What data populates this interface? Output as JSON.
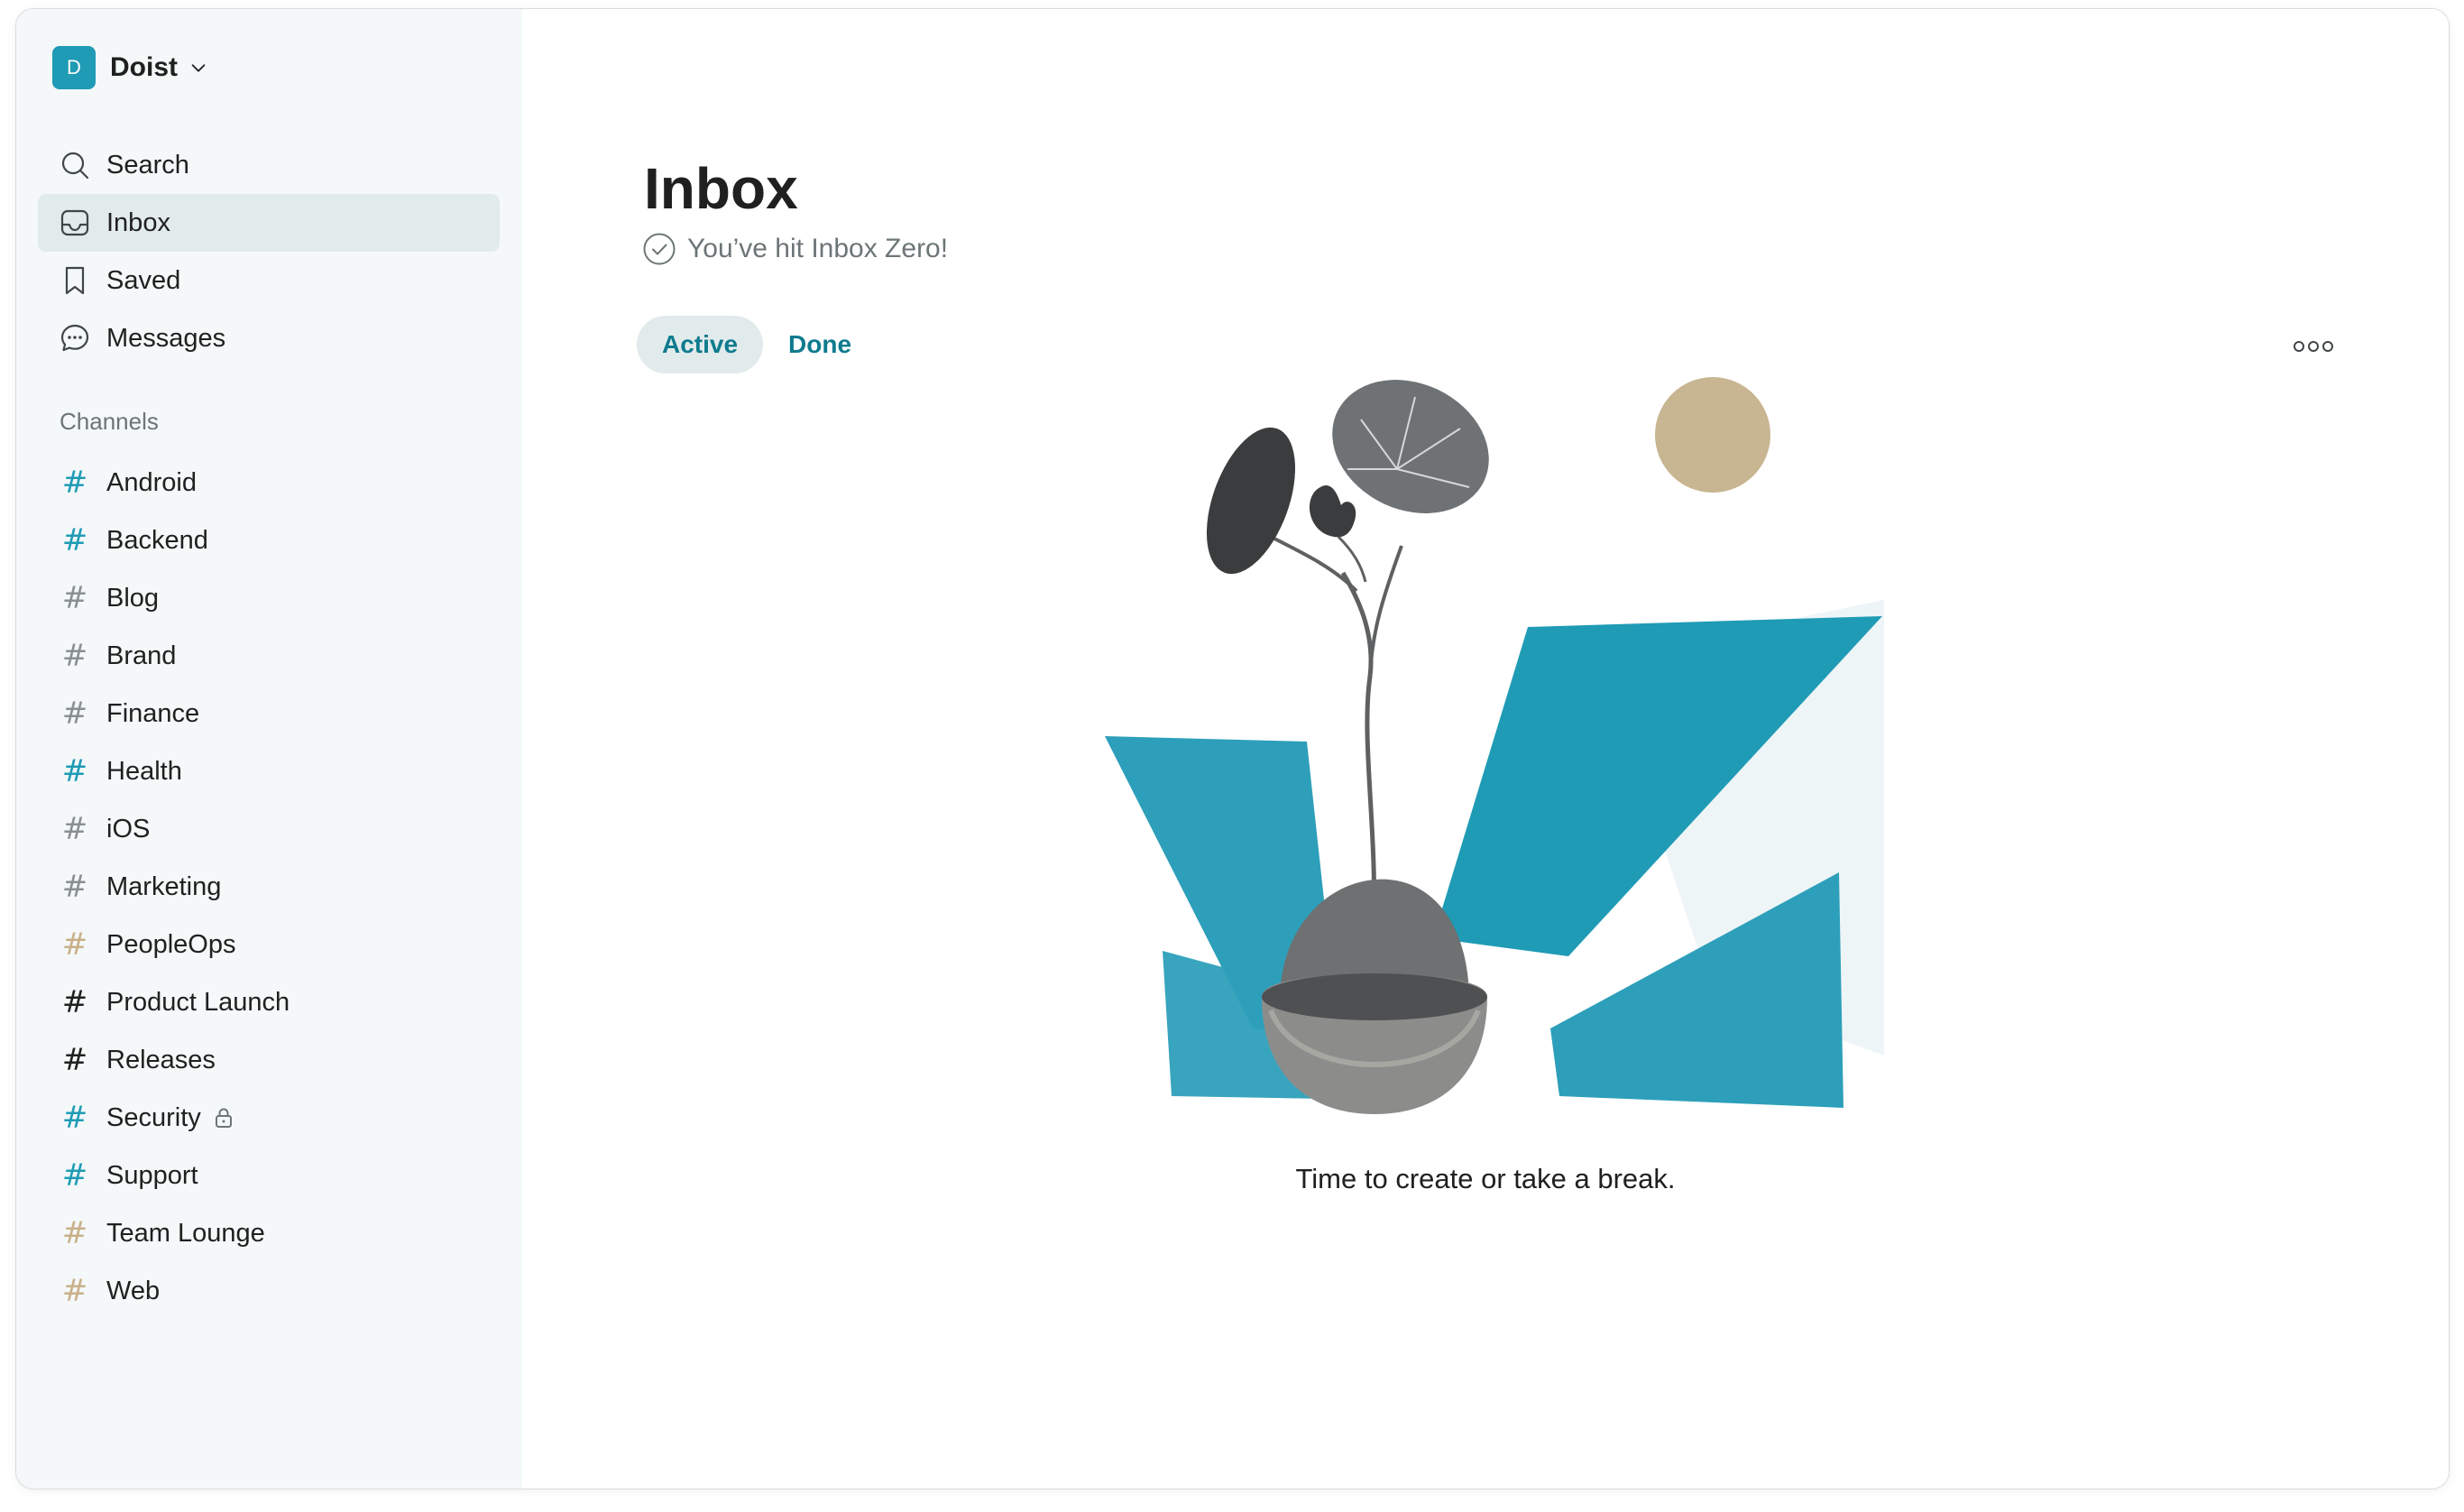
{
  "workspace": {
    "initial": "D",
    "name": "Doist"
  },
  "nav": [
    {
      "label": "Search",
      "icon": "search-icon",
      "active": false
    },
    {
      "label": "Inbox",
      "icon": "inbox-icon",
      "active": true
    },
    {
      "label": "Saved",
      "icon": "bookmark-icon",
      "active": false
    },
    {
      "label": "Messages",
      "icon": "chat-bubble-icon",
      "active": false
    }
  ],
  "channels_label": "Channels",
  "channels": [
    {
      "name": "Android",
      "color": "#1f9bb5",
      "locked": false
    },
    {
      "name": "Backend",
      "color": "#1f9bb5",
      "locked": false
    },
    {
      "name": "Blog",
      "color": "#8a8f91",
      "locked": false
    },
    {
      "name": "Brand",
      "color": "#8a8f91",
      "locked": false
    },
    {
      "name": "Finance",
      "color": "#8a8f91",
      "locked": false
    },
    {
      "name": "Health",
      "color": "#1f9bb5",
      "locked": false
    },
    {
      "name": "iOS",
      "color": "#8a8f91",
      "locked": false
    },
    {
      "name": "Marketing",
      "color": "#8a8f91",
      "locked": false
    },
    {
      "name": "PeopleOps",
      "color": "#c9b089",
      "locked": false
    },
    {
      "name": "Product Launch",
      "color": "#202020",
      "locked": false
    },
    {
      "name": "Releases",
      "color": "#202020",
      "locked": false
    },
    {
      "name": "Security",
      "color": "#1f9bb5",
      "locked": true
    },
    {
      "name": "Support",
      "color": "#1f9bb5",
      "locked": false
    },
    {
      "name": "Team Lounge",
      "color": "#c9b089",
      "locked": false
    },
    {
      "name": "Web",
      "color": "#c9b089",
      "locked": false
    }
  ],
  "main": {
    "title": "Inbox",
    "subtitle": "You’ve hit Inbox Zero!",
    "tabs": [
      {
        "label": "Active",
        "active": true
      },
      {
        "label": "Done",
        "active": false
      }
    ],
    "empty_message": "Time to create or take a break."
  },
  "colors": {
    "accent": "#1f9bb5",
    "tab_text": "#0e7b8e",
    "sidebar_bg": "#f4f8f9",
    "active_bg": "#e2ebec",
    "sun": "#c8b591"
  }
}
